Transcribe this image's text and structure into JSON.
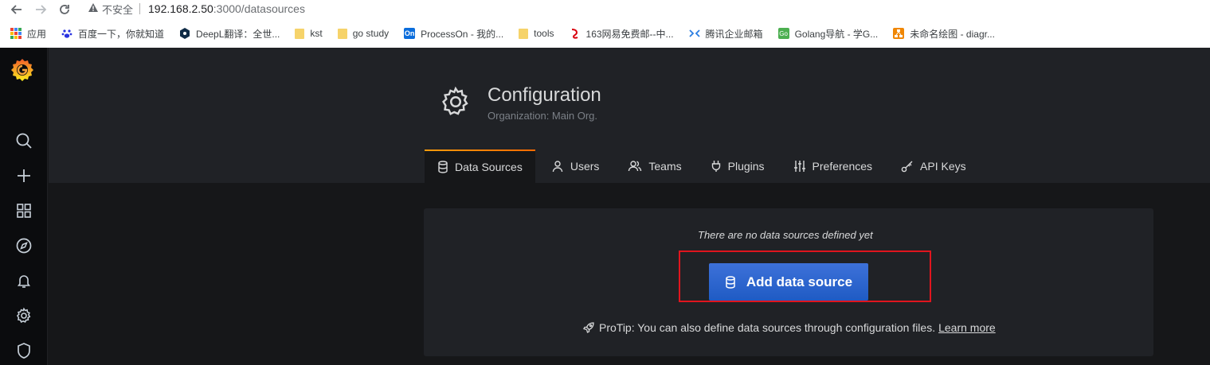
{
  "browser": {
    "insecure_label": "不安全",
    "url_host": "192.168.2.50",
    "url_path": ":3000/datasources",
    "bookmarks": [
      {
        "label": "应用",
        "icon": "apps-grid-icon"
      },
      {
        "label": "百度一下，你就知道",
        "icon": "baidu-paw-icon"
      },
      {
        "label": "DeepL翻译：全世...",
        "icon": "deepl-icon"
      },
      {
        "label": "kst",
        "icon": "folder-icon"
      },
      {
        "label": "go study",
        "icon": "folder-icon"
      },
      {
        "label": "ProcessOn - 我的...",
        "icon": "processon-icon"
      },
      {
        "label": "tools",
        "icon": "folder-icon"
      },
      {
        "label": "163网易免费邮--中...",
        "icon": "netease-icon"
      },
      {
        "label": "腾讯企业邮箱",
        "icon": "tencent-mail-icon"
      },
      {
        "label": "Golang导航 - 学G...",
        "icon": "golang-nav-icon"
      },
      {
        "label": "未命名绘图 - diagr...",
        "icon": "drawio-icon"
      }
    ],
    "bookmark_icon_glyphs": {
      "processon": "On",
      "golang": "Go"
    }
  },
  "header": {
    "title": "Configuration",
    "subtitle": "Organization: Main Org."
  },
  "tabs": [
    {
      "label": "Data Sources",
      "icon": "database-icon",
      "active": true
    },
    {
      "label": "Users",
      "icon": "user-icon",
      "active": false
    },
    {
      "label": "Teams",
      "icon": "users-icon",
      "active": false
    },
    {
      "label": "Plugins",
      "icon": "plug-icon",
      "active": false
    },
    {
      "label": "Preferences",
      "icon": "sliders-icon",
      "active": false
    },
    {
      "label": "API Keys",
      "icon": "key-icon",
      "active": false
    }
  ],
  "empty_state": {
    "message": "There are no data sources defined yet",
    "button_label": "Add data source",
    "protip": "ProTip: You can also define data sources through configuration files.",
    "learn_more": "Learn more"
  },
  "colors": {
    "accent_orange": "#f99b0c",
    "primary_blue": "#3d71d9",
    "highlight_red": "#e0151e"
  }
}
